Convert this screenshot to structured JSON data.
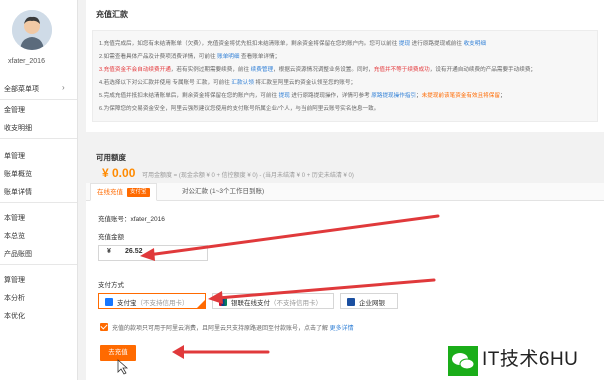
{
  "sidebar": {
    "username": "xfater_2016",
    "menu_header": "全部菜单项",
    "items": [
      {
        "label": "金管理"
      },
      {
        "label": "收支明细"
      },
      {
        "label": "单管理"
      },
      {
        "label": "账单概览"
      },
      {
        "label": "账单详情"
      },
      {
        "label": "本管理"
      },
      {
        "label": "本总览"
      },
      {
        "label": "产品账图"
      },
      {
        "label": "算管理"
      },
      {
        "label": "本分析"
      },
      {
        "label": "本优化"
      }
    ]
  },
  "recharge": {
    "section_title": "充值汇款",
    "notices": [
      {
        "parts": [
          {
            "t": "1.充值完成后，如您有未结清账单（欠费），充值资金将优先抵扣未结清账单，剩余资金将保留在您的账户内。您可以前往 ",
            "c": ""
          },
          {
            "t": "提现",
            "c": "blue"
          },
          {
            "t": " 进行原路提现或前往 ",
            "c": ""
          },
          {
            "t": "收支明细",
            "c": "blue"
          }
        ]
      },
      {
        "parts": [
          {
            "t": "2.如需查看具体产品及计费项消费详情，可前往 ",
            "c": ""
          },
          {
            "t": "账单明细",
            "c": "blue"
          },
          {
            "t": " 查看账单详情；",
            "c": ""
          }
        ]
      },
      {
        "parts": [
          {
            "t": "3.充值资金不会自动续费开通",
            "c": "red"
          },
          {
            "t": "，若有实例过期需要续费，前往 ",
            "c": ""
          },
          {
            "t": "续费管理",
            "c": "blue"
          },
          {
            "t": "，根据云资源情况调整业务设置。同时，",
            "c": ""
          },
          {
            "t": "充值并不等于续费成功",
            "c": "red"
          },
          {
            "t": "，设有开通自动续费的产品需要手动续费；",
            "c": ""
          }
        ]
      },
      {
        "parts": [
          {
            "t": "4.若选择以下对公汇款并使用 专属账号 汇款，可前往 ",
            "c": ""
          },
          {
            "t": "汇款认领",
            "c": "blue"
          },
          {
            "t": " 将汇款至阿里云的资金认领至您的账号；",
            "c": ""
          }
        ]
      },
      {
        "parts": [
          {
            "t": "5.完成充值并抵扣未结清账单后，剩余资金将保留在您的账户内，可前往 ",
            "c": ""
          },
          {
            "t": "提现",
            "c": "blue"
          },
          {
            "t": " 进行原路提现操作，详情可参考 ",
            "c": ""
          },
          {
            "t": "原路提现操作指引",
            "c": "blue"
          },
          {
            "t": "；",
            "c": ""
          },
          {
            "t": "未提现前该笔资金有效且将保留",
            "c": "orange"
          },
          {
            "t": "；",
            "c": ""
          }
        ]
      },
      {
        "parts": [
          {
            "t": "6.为保障您的交易资金安全，阿里云强烈建议您使用的支付账号所属企业/个人，与当前阿里云账号实名信息一致。",
            "c": ""
          }
        ]
      }
    ]
  },
  "available": {
    "label": "可用额度",
    "amount": "¥ 0.00",
    "note": "可用金额度 = (现金余额 ¥ 0 + 信控额度 ¥ 0) - (当月未结清 ¥ 0 + 历史未结清 ¥ 0)"
  },
  "tabs": {
    "online": "在线充值",
    "online_badge": "支付宝",
    "transfer": "对公汇款 (1~3个工作日到账)"
  },
  "form": {
    "account_label": "充值账号：",
    "account_value": "xfater_2016",
    "amount_label": "充值金额",
    "currency": "¥",
    "amount_value": "26.52",
    "payment_label": "支付方式",
    "pay_options": [
      {
        "name": "支付宝",
        "note": "（不支持信用卡）",
        "color": "#1677ff",
        "selected": true
      },
      {
        "name": "银联在线支付",
        "note": "（不支持信用卡）",
        "color": "#c8102e",
        "selected": false
      },
      {
        "name": "企业网银",
        "note": "",
        "color": "#1a4fa0",
        "selected": false
      }
    ],
    "agree_text": "充值的款项只可用于阿里云消费，且阿里云只支持原路退回至付款账号，点击了解 ",
    "agree_link": "更多详情",
    "submit": "去充值"
  },
  "watermark": {
    "text": "IT技术6HU"
  },
  "colors": {
    "accent": "#ff6a00",
    "link": "#2f7fd6",
    "warn": "#e4393c",
    "arrow": "#e0393b"
  }
}
